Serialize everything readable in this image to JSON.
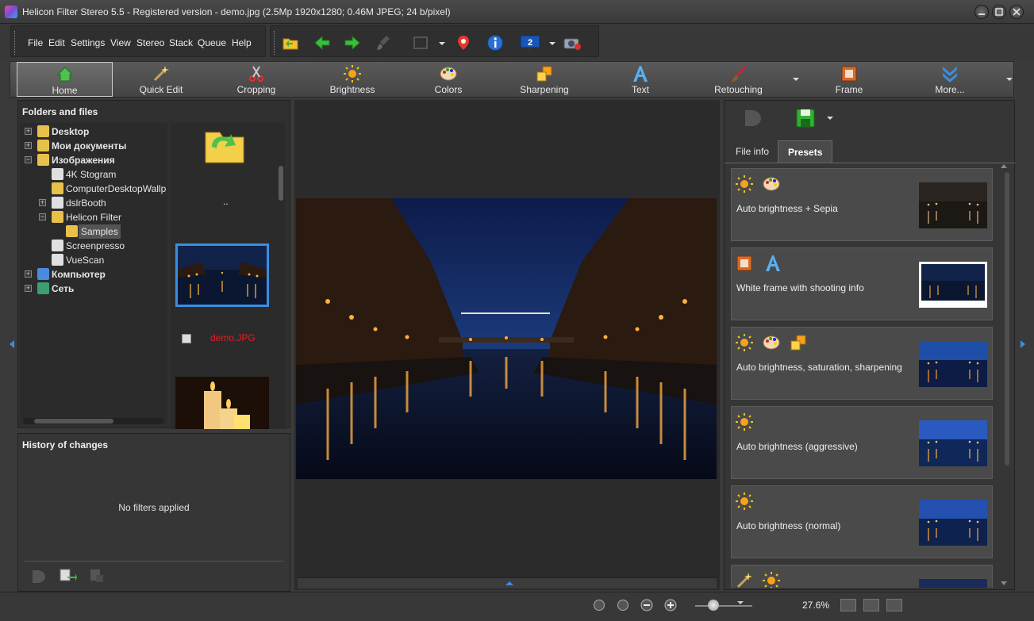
{
  "window": {
    "title": "Helicon Filter Stereo 5.5 - Registered version - demo.jpg (2.5Mp 1920x1280; 0.46M JPEG; 24 b/pixel)",
    "buttons": [
      "minimize",
      "maximize",
      "close"
    ]
  },
  "menu": {
    "items": [
      "File",
      "Edit",
      "Settings",
      "View",
      "Stereo",
      "Stack",
      "Queue",
      "Help"
    ]
  },
  "toolbar": {
    "icons": [
      "open-folder-icon",
      "back-arrow-icon",
      "forward-arrow-icon",
      "brush-icon",
      "crop-frame-icon",
      "location-pin-icon",
      "info-icon",
      "monitor-2-icon",
      "camera-icon"
    ],
    "monitor_number": "2"
  },
  "ribbon": {
    "items": [
      {
        "label": "Home",
        "icon": "home-icon",
        "active": true
      },
      {
        "label": "Quick Edit",
        "icon": "magic-wand-icon"
      },
      {
        "label": "Cropping",
        "icon": "scissors-icon"
      },
      {
        "label": "Brightness",
        "icon": "sun-icon"
      },
      {
        "label": "Colors",
        "icon": "palette-icon"
      },
      {
        "label": "Sharpening",
        "icon": "sharpening-squares-icon"
      },
      {
        "label": "Text",
        "icon": "letter-a-icon"
      },
      {
        "label": "Retouching",
        "icon": "brush-icon"
      },
      {
        "label": "Frame",
        "icon": "frame-icon"
      },
      {
        "label": "More...",
        "icon": "chevrons-down-icon"
      }
    ]
  },
  "folders": {
    "title": "Folders and files",
    "tree": [
      {
        "label": "Desktop",
        "bold": true
      },
      {
        "label": "Мои документы",
        "bold": true
      },
      {
        "label": "Изображения",
        "bold": true
      },
      {
        "label": "4K Stogram"
      },
      {
        "label": "ComputerDesktopWallp"
      },
      {
        "label": "dslrBooth"
      },
      {
        "label": "Helicon Filter"
      },
      {
        "label": "Samples",
        "selected": true
      },
      {
        "label": "Screenpresso"
      },
      {
        "label": "VueScan"
      },
      {
        "label": "Компьютер",
        "bold": true
      },
      {
        "label": "Сеть",
        "bold": true
      }
    ],
    "thumbs": {
      "up_label": "..",
      "file_label": "demo.JPG",
      "file_label_color": "#e02020"
    }
  },
  "history": {
    "title": "History of changes",
    "empty_text": "No filters applied"
  },
  "right_panel": {
    "tabs": [
      {
        "label": "File info"
      },
      {
        "label": "Presets",
        "active": true
      }
    ],
    "presets": [
      {
        "label": "Auto brightness + Sepia",
        "icons": [
          "sun-icon",
          "palette-icon"
        ]
      },
      {
        "label": "White frame with shooting info",
        "icons": [
          "frame-icon",
          "letter-a-icon"
        ]
      },
      {
        "label": "Auto brightness, saturation, sharpening",
        "icons": [
          "sun-icon",
          "palette-icon",
          "sharpening-squares-icon"
        ]
      },
      {
        "label": "Auto brightness (aggressive)",
        "icons": [
          "sun-icon"
        ]
      },
      {
        "label": "Auto brightness (normal)",
        "icons": [
          "sun-icon"
        ]
      },
      {
        "label": "",
        "icons": [
          "magic-wand-icon",
          "sun-icon"
        ]
      }
    ]
  },
  "statusbar": {
    "zoom_text": "27.6%",
    "zoom_fraction": 0.25
  },
  "colors": {
    "accent_blue": "#3a8ee0",
    "selection_border": "#3a8ee0"
  }
}
